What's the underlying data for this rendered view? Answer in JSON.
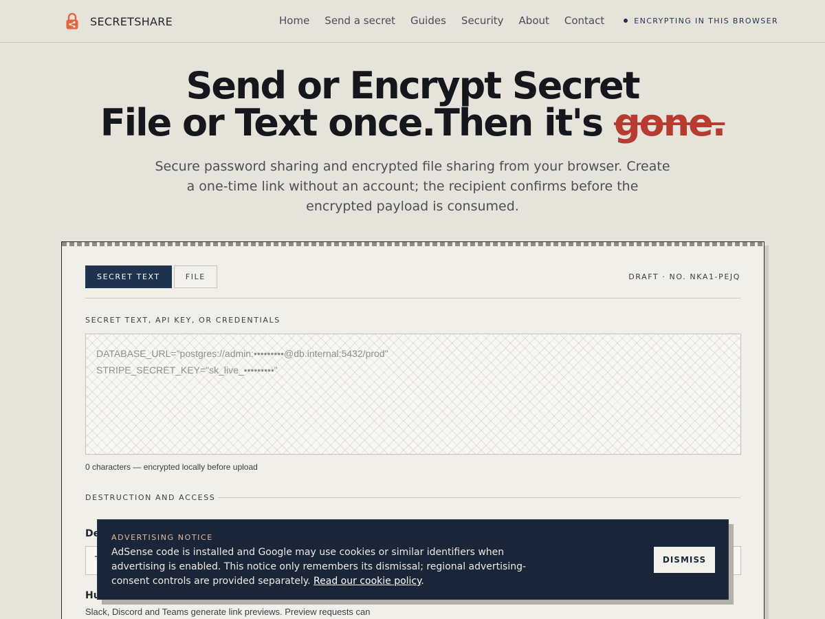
{
  "header": {
    "brand": "SECRETSHARE",
    "nav": [
      "Home",
      "Send a secret",
      "Guides",
      "Security",
      "About",
      "Contact"
    ],
    "status": "ENCRYPTING IN THIS BROWSER"
  },
  "hero": {
    "line1": "Send or Encrypt Secret",
    "line2_prefix": "File or Text once.Then it's ",
    "line2_struck": "gone.",
    "subtitle": "Secure password sharing and encrypted file sharing from your browser. Create a one-time link without an account; the recipient confirms before the encrypted payload is consumed."
  },
  "card": {
    "tabs": [
      "SECRET TEXT",
      "FILE"
    ],
    "active_tab": "SECRET TEXT",
    "draft_no": "DRAFT · NO. NKA1-PEJQ",
    "field_label": "SECRET TEXT, API KEY, OR CREDENTIALS",
    "value": "",
    "placeholder_lines": [
      "DATABASE_URL=\"postgres://admin:•••••••••@db.internal:5432/prod\"",
      "STRIPE_SECRET_KEY=\"sk_live_•••••••••\""
    ],
    "char_count": "0 characters — encrypted locally before upload",
    "section_heading": "DESTRUCTION AND ACCESS",
    "destroy_label": "De",
    "destroy_value": "T",
    "human_label": "Hu",
    "help_text": "Slack, Discord and Teams generate link previews. Preview requests can"
  },
  "notice": {
    "title": "ADVERTISING NOTICE",
    "body": "AdSense code is installed and Google may use cookies or similar identifiers when advertising is enabled. This notice only remembers its dismissal; regional advertising-consent controls are provided separately. ",
    "link": "Read our cookie policy",
    "after_link": ".",
    "dismiss": "DISMISS"
  },
  "colors": {
    "background": "#e6e3db",
    "navy": "#1f3350",
    "accent_red": "#b73b2e",
    "brand_orange": "#e0683e"
  },
  "icons": [
    "lock-icon",
    "status-dot-icon"
  ]
}
